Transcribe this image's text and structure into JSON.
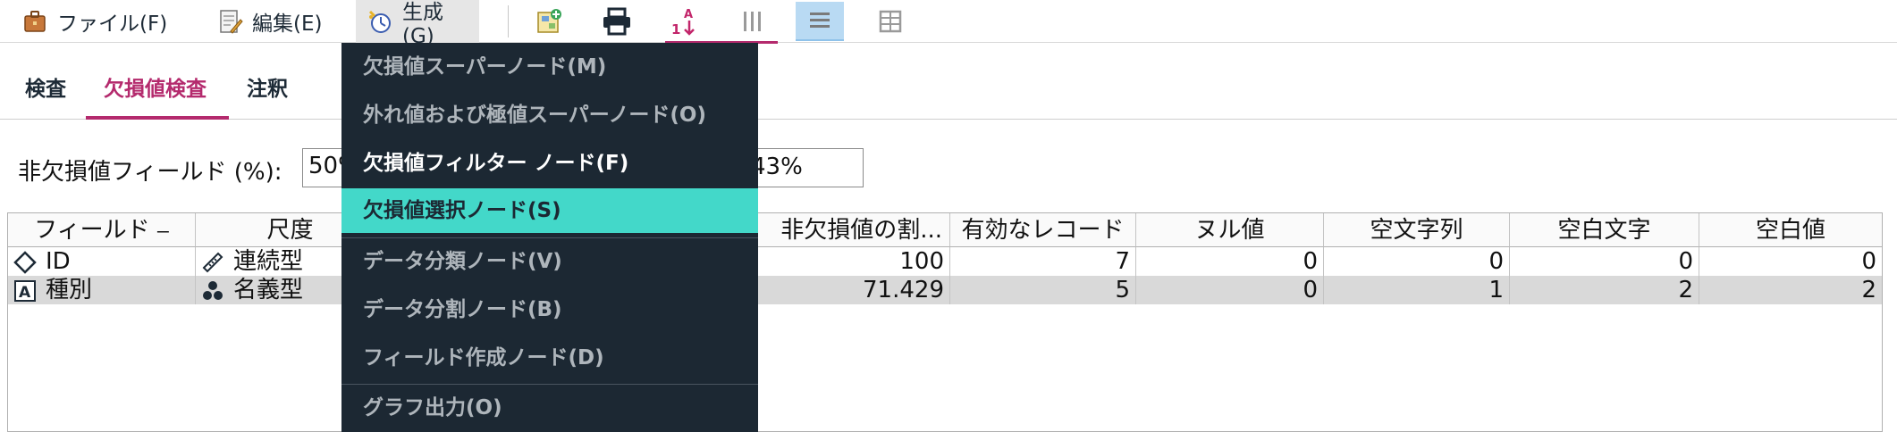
{
  "menubar": {
    "file": "ファイル(F)",
    "edit": "編集(E)",
    "generate": "生成(G)"
  },
  "toolbar_icons": [
    "add-node-icon",
    "print-icon",
    "sort-icon",
    "column-view-icon",
    "list-view-icon",
    "grid-view-icon"
  ],
  "tabs": [
    {
      "label": "検査"
    },
    {
      "label": "欠損値検査"
    },
    {
      "label": "注釈"
    }
  ],
  "threshold": {
    "label": "非欠損値フィールド (%):",
    "value": "50%",
    "suffix": "43%"
  },
  "table": {
    "headers": [
      "フィールド ⎯",
      "尺度",
      "非欠損値の割...",
      "有効なレコード",
      "ヌル値",
      "空文字列",
      "空白文字",
      "空白値"
    ],
    "rows": [
      {
        "field": "ID",
        "field_icon": "continuous-id-icon",
        "measure": "連続型",
        "measure_icon": "ruler-icon",
        "nonmissing": "100",
        "valid": "7",
        "null": "0",
        "empty": "0",
        "whitespace": "0",
        "blank": "0"
      },
      {
        "field": "種別",
        "field_icon": "text-a-icon",
        "measure": "名義型",
        "measure_icon": "nominal-icon",
        "nonmissing": "71.429",
        "valid": "5",
        "null": "0",
        "empty": "1",
        "whitespace": "2",
        "blank": "2"
      }
    ]
  },
  "dropdown": {
    "items": [
      {
        "label": "欠損値スーパーノード(M)",
        "enabled": false
      },
      {
        "label": "外れ値および極値スーパーノード(O)",
        "enabled": false
      },
      {
        "label": "欠損値フィルター ノード(F)",
        "enabled": true
      },
      {
        "label": "欠損値選択ノード(S)",
        "enabled": true,
        "selected": true
      },
      {
        "label": "データ分類ノード(V)",
        "enabled": false
      },
      {
        "label": "データ分割ノード(B)",
        "enabled": false
      },
      {
        "label": "フィールド作成ノード(D)",
        "enabled": false
      },
      {
        "label": "グラフ出力(O)",
        "enabled": false
      }
    ]
  },
  "colors": {
    "accent": "#b42a6d",
    "menu_bg": "#1c2833",
    "menu_selected": "#43d8c9"
  }
}
